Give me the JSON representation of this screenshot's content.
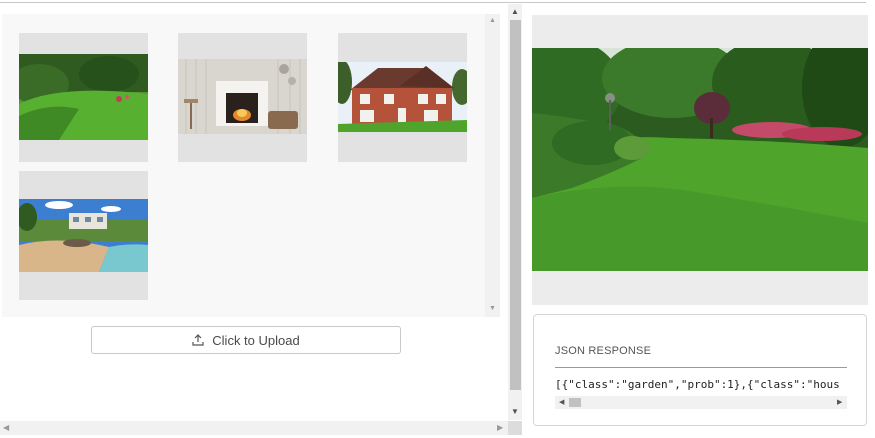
{
  "gallery": {
    "images": [
      {
        "name": "garden"
      },
      {
        "name": "fireplace"
      },
      {
        "name": "house"
      },
      {
        "name": "beach-house"
      }
    ]
  },
  "upload": {
    "label": "Click to Upload"
  },
  "json_response": {
    "title": "JSON RESPONSE",
    "text": "[{\"class\":\"garden\",\"prob\":1},{\"class\":\"hous"
  },
  "colors": {
    "grass": "#4fa52b",
    "foliage": "#2f6b22",
    "sky": "#e6eef5"
  }
}
